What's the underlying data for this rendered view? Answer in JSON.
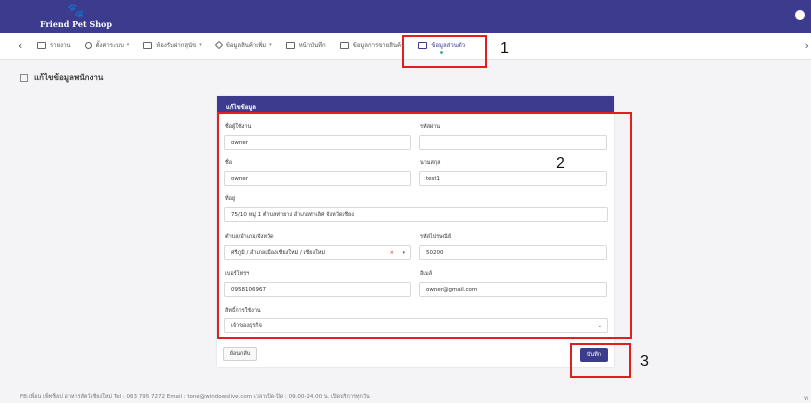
{
  "app": {
    "logo_mark": "🐾",
    "logo_text": "Friend Pet Shop"
  },
  "nav": {
    "left_arrow": "‹",
    "right_arrow": "›",
    "items": [
      {
        "label": "รายงาน",
        "icon": "report-icon",
        "dropdown": false
      },
      {
        "label": "ตั้งค่าระบบ",
        "icon": "gear-icon",
        "dropdown": true
      },
      {
        "label": "ห้องรับฝากสุนัข",
        "icon": "kennel-icon",
        "dropdown": true
      },
      {
        "label": "ข้อมูลสินค้าเพิ่ม",
        "icon": "diamond-icon",
        "dropdown": true
      },
      {
        "label": "หน้าบันทึก",
        "icon": "home-icon",
        "dropdown": false
      },
      {
        "label": "ข้อมูลการขายสินค้า",
        "icon": "monitor-icon",
        "dropdown": false
      },
      {
        "label": "ข้อมูลส่วนตัว",
        "icon": "profile-icon",
        "dropdown": false
      }
    ]
  },
  "page": {
    "title": "แก้ไขข้อมูลพนักงาน"
  },
  "form": {
    "header": "แก้ไขข้อมูล",
    "username": {
      "label": "ชื่อผู้ใช้งาน",
      "value": "owner"
    },
    "password": {
      "label": "รหัสผ่าน",
      "value": ""
    },
    "first_name": {
      "label": "ชื่อ",
      "value": "owner"
    },
    "last_name": {
      "label": "นามสกุล",
      "value": "test1"
    },
    "address": {
      "label": "ที่อยู่",
      "value": "75/10 หมู่ 1 ตำบลท่ายาง อำเภอท่าเลิศ จังหวัดเชียง"
    },
    "district": {
      "label": "ตำบล/อำเภอ/จังหวัด",
      "value": "ศรีภูมิ / อำเภอเมืองเชียงใหม่ / เชียงใหม่",
      "clear": "×",
      "caret": "▾"
    },
    "postcode": {
      "label": "รหัสไปรษณีย์",
      "value": "50200"
    },
    "phone": {
      "label": "เบอร์โทรฯ",
      "value": "0958106967"
    },
    "email": {
      "label": "อีเมล์",
      "value": "owner@gmail.com"
    },
    "role": {
      "label": "สิทธิ์การใช้งาน",
      "value": "เจ้าของธุรกิจ",
      "caret": "⌄"
    },
    "cancel_label": "ย้อนกลับ",
    "save_label": "บันทึก"
  },
  "annotations": {
    "m1": "1",
    "m2": "2",
    "m3": "3"
  },
  "footer": {
    "text": "FB:เพื่อน เพ็ทช็อป อาหารสัตว์เชียงใหม่  Tel : 063 795 7272  Email : tone@windowslive.com  เวลาเปิด-ปิด : 09.00-24.00 น. เปิดบริการทุกวัน",
    "right": "ท"
  },
  "colors": {
    "brand": "#3d3b8e",
    "highlight": "#e02020"
  }
}
